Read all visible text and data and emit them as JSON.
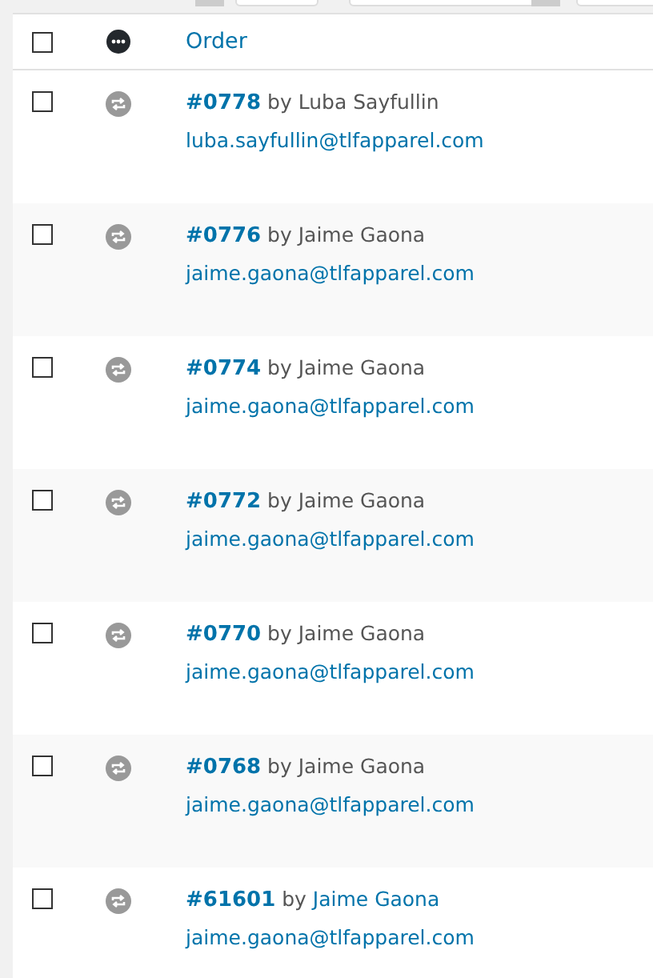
{
  "table": {
    "columns": [
      {
        "kind": "checkbox",
        "checked": false
      },
      {
        "kind": "status"
      },
      {
        "kind": "text",
        "label": "Order"
      }
    ],
    "rows": [
      {
        "checked": false,
        "order": "#0778",
        "by": "by",
        "customer": "Luba Sayfullin",
        "customer_linked": false,
        "email": "luba.sayfullin@tlfapparel.com"
      },
      {
        "checked": false,
        "order": "#0776",
        "by": "by",
        "customer": "Jaime Gaona",
        "customer_linked": false,
        "email": "jaime.gaona@tlfapparel.com"
      },
      {
        "checked": false,
        "order": "#0774",
        "by": "by",
        "customer": "Jaime Gaona",
        "customer_linked": false,
        "email": "jaime.gaona@tlfapparel.com"
      },
      {
        "checked": false,
        "order": "#0772",
        "by": "by",
        "customer": "Jaime Gaona",
        "customer_linked": false,
        "email": "jaime.gaona@tlfapparel.com"
      },
      {
        "checked": false,
        "order": "#0770",
        "by": "by",
        "customer": "Jaime Gaona",
        "customer_linked": false,
        "email": "jaime.gaona@tlfapparel.com"
      },
      {
        "checked": false,
        "order": "#0768",
        "by": "by",
        "customer": "Jaime Gaona",
        "customer_linked": false,
        "email": "jaime.gaona@tlfapparel.com"
      },
      {
        "checked": false,
        "order": "#61601",
        "by": "by",
        "customer": "Jaime Gaona",
        "customer_linked": true,
        "email": "jaime.gaona@tlfapparel.com"
      }
    ]
  }
}
